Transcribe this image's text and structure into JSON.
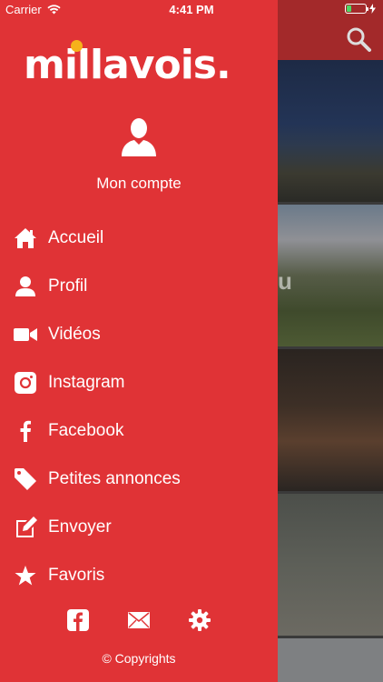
{
  "status_bar": {
    "carrier": "Carrier",
    "time": "4:41 PM",
    "battery_level": 0.25
  },
  "drawer": {
    "logo": "millavois.",
    "account_label": "Mon compte",
    "menu": [
      {
        "label": "Accueil",
        "icon": "home-icon"
      },
      {
        "label": "Profil",
        "icon": "user-icon"
      },
      {
        "label": "Vidéos",
        "icon": "video-camera-icon"
      },
      {
        "label": "Instagram",
        "icon": "instagram-icon"
      },
      {
        "label": "Facebook",
        "icon": "facebook-icon"
      },
      {
        "label": "Petites annonces",
        "icon": "tag-icon"
      },
      {
        "label": "Envoyer",
        "icon": "edit-icon"
      },
      {
        "label": "Favoris",
        "icon": "star-icon"
      }
    ],
    "footer_icons": [
      "facebook-square-icon",
      "mail-icon",
      "gear-icon"
    ],
    "copyright": "© Copyrights"
  },
  "background": {
    "partial_letter": "u"
  },
  "colors": {
    "drawer_bg": "#e03336",
    "logo_dot": "#f6b21a",
    "header_bg": "#a3292a"
  }
}
